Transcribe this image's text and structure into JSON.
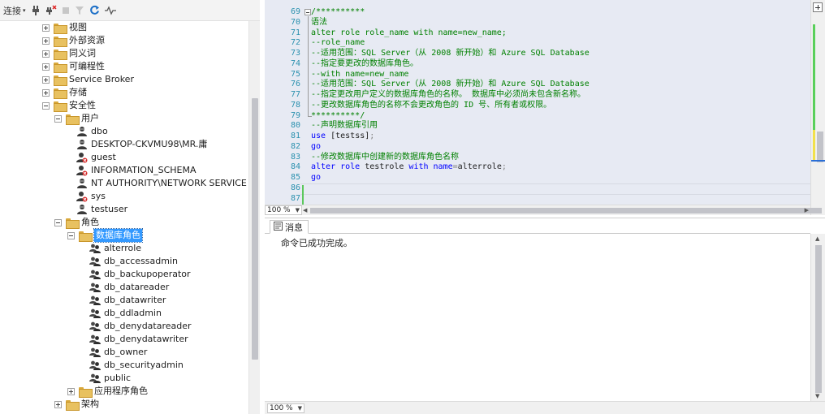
{
  "explorer": {
    "toolbar": {
      "connect_label": "连接"
    },
    "tree": [
      {
        "label": "视图",
        "expander": "plus",
        "icon": "folder-icon"
      },
      {
        "label": "外部资源",
        "expander": "plus",
        "icon": "folder-icon"
      },
      {
        "label": "同义词",
        "expander": "plus",
        "icon": "folder-icon"
      },
      {
        "label": "可编程性",
        "expander": "plus",
        "icon": "folder-icon"
      },
      {
        "label": "Service Broker",
        "expander": "plus",
        "icon": "folder-icon"
      },
      {
        "label": "存储",
        "expander": "plus",
        "icon": "folder-icon"
      },
      {
        "label": "安全性",
        "expander": "minus",
        "icon": "folder-icon"
      },
      {
        "label": "用户",
        "expander": "minus",
        "icon": "folder-icon"
      },
      {
        "label": "dbo",
        "icon": "user-icon"
      },
      {
        "label": "DESKTOP-CKVMU98\\MR.庸",
        "icon": "user-icon"
      },
      {
        "label": "guest",
        "icon": "disabled-user-icon"
      },
      {
        "label": "INFORMATION_SCHEMA",
        "icon": "disabled-user-icon"
      },
      {
        "label": "NT AUTHORITY\\NETWORK SERVICE",
        "icon": "user-icon"
      },
      {
        "label": "sys",
        "icon": "disabled-user-icon"
      },
      {
        "label": "testuser",
        "icon": "user-icon"
      },
      {
        "label": "角色",
        "expander": "minus",
        "icon": "folder-icon"
      },
      {
        "label": "数据库角色",
        "expander": "minus",
        "icon": "folder-icon",
        "selected": true
      },
      {
        "label": "alterrole",
        "icon": "role-icon"
      },
      {
        "label": "db_accessadmin",
        "icon": "role-icon"
      },
      {
        "label": "db_backupoperator",
        "icon": "role-icon"
      },
      {
        "label": "db_datareader",
        "icon": "role-icon"
      },
      {
        "label": "db_datawriter",
        "icon": "role-icon"
      },
      {
        "label": "db_ddladmin",
        "icon": "role-icon"
      },
      {
        "label": "db_denydatareader",
        "icon": "role-icon"
      },
      {
        "label": "db_denydatawriter",
        "icon": "role-icon"
      },
      {
        "label": "db_owner",
        "icon": "role-icon"
      },
      {
        "label": "db_securityadmin",
        "icon": "role-icon"
      },
      {
        "label": "public",
        "icon": "role-icon"
      },
      {
        "label": "应用程序角色",
        "expander": "plus",
        "icon": "folder-icon"
      },
      {
        "label": "架构",
        "expander": "plus",
        "icon": "folder-icon"
      }
    ]
  },
  "editor": {
    "zoom": "100 %",
    "lines": [
      {
        "num": "69",
        "segments": [
          {
            "text": "/**********",
            "style": "comment"
          }
        ]
      },
      {
        "num": "70",
        "segments": [
          {
            "text": "语法",
            "style": "comment"
          }
        ]
      },
      {
        "num": "71",
        "segments": [
          {
            "text": "alter role role_name with name=new_name;",
            "style": "comment"
          }
        ]
      },
      {
        "num": "72",
        "segments": [
          {
            "text": "--role_name",
            "style": "comment"
          }
        ]
      },
      {
        "num": "73",
        "segments": [
          {
            "text": "--适用范围：SQL Server（从 2008 新开始）和 Azure SQL Database",
            "style": "comment"
          }
        ]
      },
      {
        "num": "74",
        "segments": [
          {
            "text": "--指定要更改的数据库角色。",
            "style": "comment"
          }
        ]
      },
      {
        "num": "75",
        "segments": [
          {
            "text": "--with name=new_name",
            "style": "comment"
          }
        ]
      },
      {
        "num": "76",
        "segments": [
          {
            "text": "--适用范围：SQL Server（从 2008 新开始）和 Azure SQL Database",
            "style": "comment"
          }
        ]
      },
      {
        "num": "77",
        "segments": [
          {
            "text": "--指定更改用户定义的数据库角色的名称。 数据库中必须尚未包含新名称。",
            "style": "comment"
          }
        ]
      },
      {
        "num": "78",
        "segments": [
          {
            "text": "--更改数据库角色的名称不会更改角色的 ID 号、所有者或权限。",
            "style": "comment"
          }
        ]
      },
      {
        "num": "79",
        "segments": [
          {
            "text": "**********/",
            "style": "comment"
          }
        ]
      },
      {
        "num": "80",
        "segments": [
          {
            "text": "--声明数据库引用",
            "style": "comment"
          }
        ]
      },
      {
        "num": "81",
        "segments": [
          {
            "text": "use ",
            "style": "kw"
          },
          {
            "text": "[testss]",
            "style": "plain"
          },
          {
            "text": ";",
            "style": "gray"
          }
        ]
      },
      {
        "num": "82",
        "segments": [
          {
            "text": "go",
            "style": "kw"
          }
        ]
      },
      {
        "num": "83",
        "segments": [
          {
            "text": "--修改数据库中创建新的数据库角色名称",
            "style": "comment"
          }
        ]
      },
      {
        "num": "84",
        "segments": [
          {
            "text": "alter role ",
            "style": "kw"
          },
          {
            "text": "testrole ",
            "style": "plain"
          },
          {
            "text": "with ",
            "style": "kw"
          },
          {
            "text": "name",
            "style": "kw"
          },
          {
            "text": "=",
            "style": "gray"
          },
          {
            "text": "alterrole",
            "style": "plain"
          },
          {
            "text": ";",
            "style": "gray"
          }
        ]
      },
      {
        "num": "85",
        "segments": [
          {
            "text": "go",
            "style": "kw"
          }
        ]
      },
      {
        "num": "86",
        "segments": [
          {
            "text": "",
            "style": "plain"
          }
        ]
      },
      {
        "num": "87",
        "segments": [
          {
            "text": "",
            "style": "plain"
          }
        ]
      }
    ]
  },
  "messages": {
    "tab_label": "消息",
    "text": "命令已成功完成。",
    "zoom": "100 %"
  }
}
